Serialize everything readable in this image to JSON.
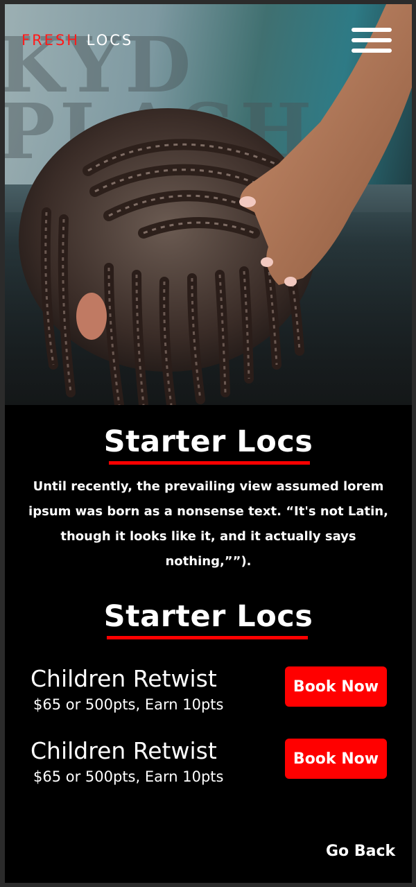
{
  "header": {
    "logo_part1": "FRESH",
    "logo_part2": "LOCS",
    "menu_icon": "hamburger-menu-icon"
  },
  "hero": {
    "background_text": "KYD PLASH"
  },
  "section1": {
    "title": "Starter Locs",
    "description": "Until recently, the prevailing view assumed lorem ipsum was born as a nonsense text. “It's not Latin, though it looks like it, and it actually says nothing,””)."
  },
  "section2": {
    "title": "Starter Locs",
    "services": [
      {
        "name": "Children Retwist",
        "price": "$65 or 500pts, Earn 10pts",
        "button": "Book Now"
      },
      {
        "name": "Children Retwist",
        "price": "$65 or 500pts, Earn 10pts",
        "button": "Book Now"
      }
    ]
  },
  "footer": {
    "go_back": "Go Back"
  },
  "colors": {
    "accent": "#ff0000",
    "background": "#000000",
    "text": "#ffffff"
  }
}
